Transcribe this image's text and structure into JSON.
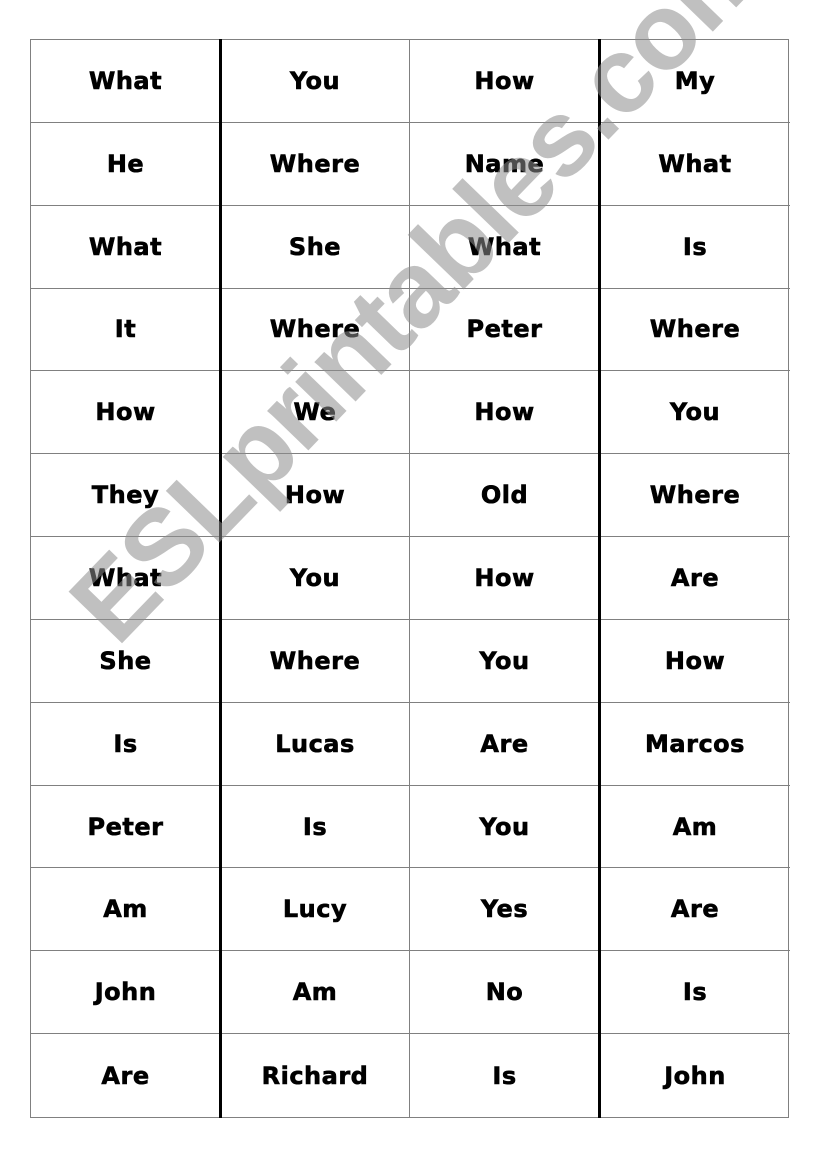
{
  "grid": {
    "rows": [
      [
        "What",
        "You",
        "How",
        "My"
      ],
      [
        "He",
        "Where",
        "Name",
        "What"
      ],
      [
        "What",
        "She",
        "What",
        "Is"
      ],
      [
        "It",
        "Where",
        "Peter",
        "Where"
      ],
      [
        "How",
        "We",
        "How",
        "You"
      ],
      [
        "They",
        "How",
        "Old",
        "Where"
      ],
      [
        "What",
        "You",
        "How",
        "Are"
      ],
      [
        "She",
        "Where",
        "You",
        "How"
      ],
      [
        "Is",
        "Lucas",
        "Are",
        "Marcos"
      ],
      [
        "Peter",
        "Is",
        "You",
        "Am"
      ],
      [
        "Am",
        "Lucy",
        "Yes",
        "Are"
      ],
      [
        "John",
        "Am",
        "No",
        "Is"
      ],
      [
        "Are",
        "Richard",
        "Is",
        "John"
      ]
    ]
  },
  "watermark": {
    "text": "ESLprintables.com"
  }
}
